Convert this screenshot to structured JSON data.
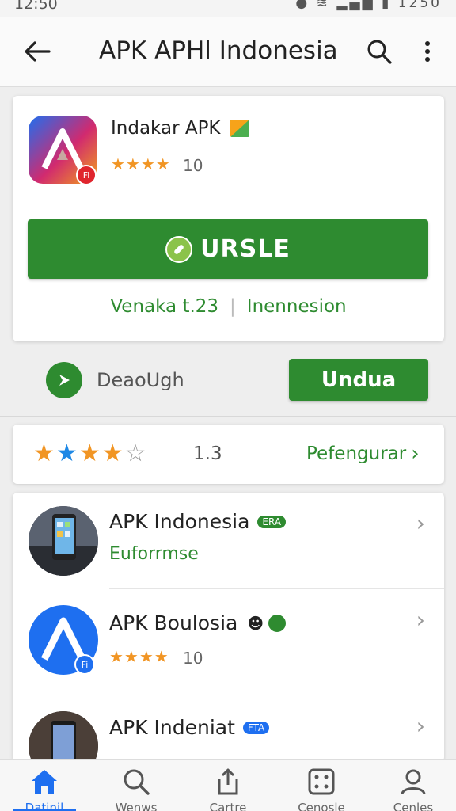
{
  "status_bar": {
    "time": "12:50",
    "right_text": "1250",
    "icons": [
      "notification-icon",
      "wifi-icon",
      "signal-icon",
      "battery-icon"
    ]
  },
  "appbar": {
    "title": "APK APHl Indonesia",
    "back_icon": "arrow-left-icon",
    "search_icon": "search-icon",
    "more_icon": "more-vert-icon"
  },
  "app": {
    "name": "Indakar APK",
    "stars": "★★★★",
    "rating": "10",
    "badge_text": "Fi",
    "install_label": "URSLE",
    "version": "Venaka t.23",
    "extension": "Inennesion"
  },
  "download": {
    "label": "DeaoUgh",
    "button_label": "Undua"
  },
  "rating_summary": {
    "value": "1.3",
    "link_label": "Pefengurar",
    "stars_filled": 4,
    "stars_total": 5
  },
  "list": [
    {
      "title": "APK Indonesia",
      "tag": "ERA",
      "tag_color": "#2e8b30",
      "subtitle": "Euforrmse"
    },
    {
      "title": "APK Boulosia",
      "stars": "★★★★",
      "rating": "10",
      "badge_text": "Fi"
    },
    {
      "title": "APK Indeniat",
      "tag": "FTA",
      "tag_color": "#1e6ff0"
    }
  ],
  "nav": [
    {
      "label": "Datinil",
      "icon": "home-icon",
      "active": true
    },
    {
      "label": "Wenws",
      "icon": "search-icon"
    },
    {
      "label": "Cartre",
      "icon": "share-icon"
    },
    {
      "label": "Cenosle",
      "icon": "dice-icon"
    },
    {
      "label": "Cenles",
      "icon": "person-icon"
    }
  ],
  "colors": {
    "primary_green": "#2e8b30",
    "accent_blue": "#1e6ff0",
    "star_orange": "#f19524"
  }
}
